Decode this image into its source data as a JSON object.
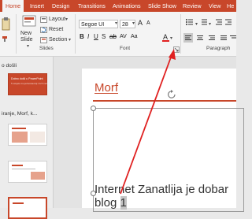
{
  "ribbon": {
    "tabs": [
      "Home",
      "Insert",
      "Design",
      "Transitions",
      "Animations",
      "Slide Show",
      "Review",
      "View",
      "He"
    ],
    "active_tab": "Home",
    "groups": {
      "slides": "Slides",
      "font": "Font",
      "paragraph": "Paragraph"
    },
    "new_slide_label": "New Slide",
    "layout_label": "Layout",
    "reset_label": "Reset",
    "section_label": "Section",
    "font_name": "Segoe UI",
    "font_size": "28",
    "accent_color": "#c8472a"
  },
  "panel": {
    "header_fragment": "o došli",
    "section_fragment": "iranje, Morf, k...",
    "thumb1_title": "Dobro došli u PowerPoint",
    "thumb1_subtitle": "5 savjeta za jednostavniji i brži rad"
  },
  "slide": {
    "title": "Morf",
    "body_line1": "Internet Zanatlija je dobar",
    "body_line2_prefix": "blog ",
    "body_line2_selected": "1"
  },
  "icons": [
    "clipboard-icon",
    "new-slide-icon",
    "layout-icon",
    "reset-icon",
    "section-icon",
    "font-color-icon",
    "dialog-launcher-icon",
    "rotate-handle-icon"
  ]
}
